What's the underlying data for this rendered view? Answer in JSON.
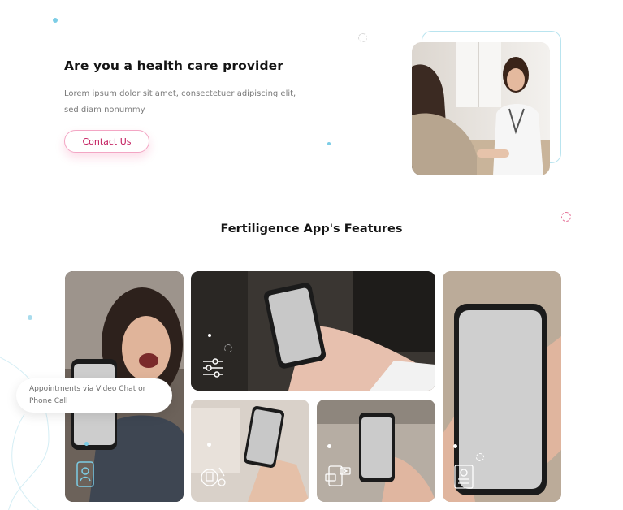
{
  "hero": {
    "title": "Are you a health care provider",
    "description": "Lorem ipsum dolor sit amet, consectetuer adipiscing elit, sed diam nonummy",
    "contact_label": "Contact Us",
    "image_icon": "doctor-patient-photo"
  },
  "features": {
    "title": "Fertiligence App's Features",
    "callout_text": "Appointments via Video Chat or Phone Call",
    "cards": [
      {
        "icon": "contact-card-icon"
      },
      {
        "icon": "sliders-icon"
      },
      {
        "icon": "medical-tools-icon"
      },
      {
        "icon": "chat-video-icon"
      },
      {
        "icon": "medical-report-icon"
      }
    ]
  },
  "colors": {
    "accent": "#c2185b",
    "accent_border": "#f3a6c4",
    "teal_dot": "#7ccde6",
    "frame_outline": "#b9e4ef",
    "heading": "#151515",
    "body_text": "#7a7a7a"
  }
}
